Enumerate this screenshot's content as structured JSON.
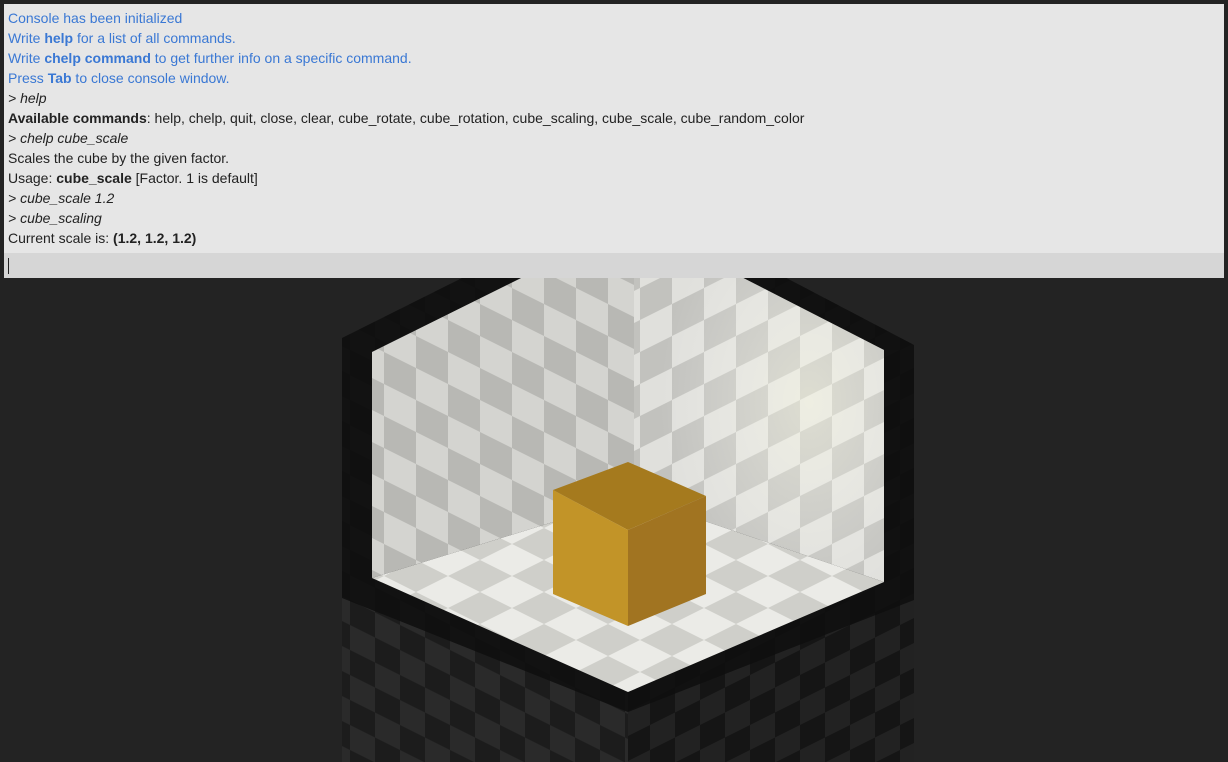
{
  "console": {
    "intro": {
      "line1": "Console has been initialized",
      "line2": {
        "before": "Write ",
        "bold": "help",
        "after": " for a list of all commands."
      },
      "line3": {
        "before": "Write ",
        "bold": "chelp command",
        "after": " to get further info on a specific command."
      },
      "line4": {
        "before": "Press ",
        "bold": "Tab",
        "after": " to close console window."
      }
    },
    "echo_help": "> help",
    "available": {
      "label": "Available commands",
      "list": ": help, chelp, quit, close, clear, cube_rotate, cube_rotation, cube_scaling, cube_scale, cube_random_color"
    },
    "echo_chelp": "> chelp cube_scale",
    "desc": "Scales the cube by the given factor.",
    "usage": {
      "prefix": "Usage: ",
      "command": "cube_scale",
      "args": " [Factor. 1 is default]"
    },
    "echo_scale": "> cube_scale 1.2",
    "echo_scaling": "> cube_scaling",
    "current": {
      "prefix": "Current scale is: ",
      "value": "(1.2, 1.2, 1.2)"
    },
    "input": {
      "value": ""
    }
  },
  "scene": {
    "cube_color": "#c4952e",
    "background": "#232323",
    "cube_scale": [
      1.2,
      1.2,
      1.2
    ]
  }
}
